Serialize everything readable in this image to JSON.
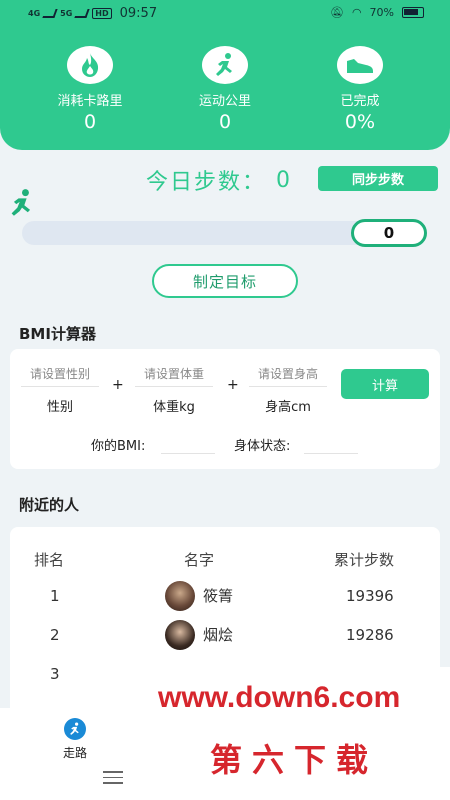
{
  "status_bar": {
    "network_a": "4G",
    "network_b": "5G",
    "hd": "HD",
    "time": "09:57",
    "battery": "70%"
  },
  "header": {
    "stats": [
      {
        "icon": "fire-icon",
        "label": "消耗卡路里",
        "value": "0"
      },
      {
        "icon": "runner-icon",
        "label": "运动公里",
        "value": "0"
      },
      {
        "icon": "shoe-icon",
        "label": "已完成",
        "value": "0%"
      }
    ]
  },
  "steps": {
    "title": "今日步数：",
    "value": "0",
    "sync_label": "同步步数",
    "progress_value": "0",
    "progress_fraction": 0
  },
  "goal_label": "制定目标",
  "bmi": {
    "title": "BMI计算器",
    "gender": {
      "placeholder": "请设置性别",
      "label": "性别"
    },
    "weight": {
      "placeholder": "请设置体重",
      "label": "体重kg"
    },
    "height": {
      "placeholder": "请设置身高",
      "label": "身高cm"
    },
    "plus": "+",
    "calc_label": "计算",
    "result_label": "你的BMI:",
    "status_label": "身体状态:"
  },
  "nearby": {
    "title": "附近的人",
    "columns": [
      "排名",
      "名字",
      "累计步数"
    ],
    "rows": [
      {
        "rank": "1",
        "name": "筱箐",
        "steps": "19396"
      },
      {
        "rank": "2",
        "name": "烟烩",
        "steps": "19286"
      },
      {
        "rank": "3",
        "name": "",
        "steps": ""
      }
    ]
  },
  "nav": {
    "walk_label": "走路"
  },
  "watermark": {
    "url": "www.down6.com",
    "cn": "第六下载"
  },
  "colors": {
    "accent": "#2fc98f",
    "watermark": "#d6262d"
  }
}
